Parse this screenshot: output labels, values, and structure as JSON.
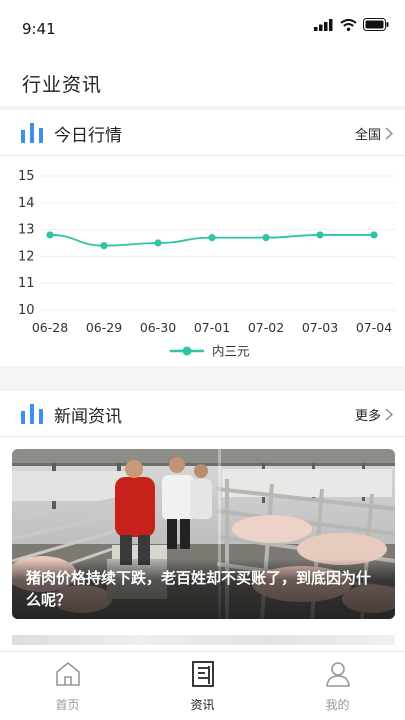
{
  "status": {
    "time": "9:41"
  },
  "page": {
    "title": "行业资讯"
  },
  "market": {
    "title": "今日行情",
    "region": "全国"
  },
  "news": {
    "title": "新闻资讯",
    "more": "更多",
    "headline": "猪肉价格持续下跌，老百姓却不买账了，到底因为什么呢？"
  },
  "tabs": [
    {
      "label": "首页",
      "icon": "home-icon",
      "active": false
    },
    {
      "label": "资讯",
      "icon": "news-icon",
      "active": true
    },
    {
      "label": "我的",
      "icon": "profile-icon",
      "active": false
    }
  ],
  "colors": {
    "accent": "#2ec4a5",
    "icon_blue": "#3b8ff0"
  },
  "chart_data": {
    "type": "line",
    "categories": [
      "06-28",
      "06-29",
      "06-30",
      "07-01",
      "07-02",
      "07-03",
      "07-04"
    ],
    "series": [
      {
        "name": "内三元",
        "values": [
          12.8,
          12.4,
          12.5,
          12.7,
          12.7,
          12.8,
          12.8
        ]
      }
    ],
    "ylim": [
      10,
      15
    ],
    "yticks": [
      10,
      11,
      12,
      13,
      14,
      15
    ],
    "grid": true,
    "legend": "bottom-center"
  }
}
